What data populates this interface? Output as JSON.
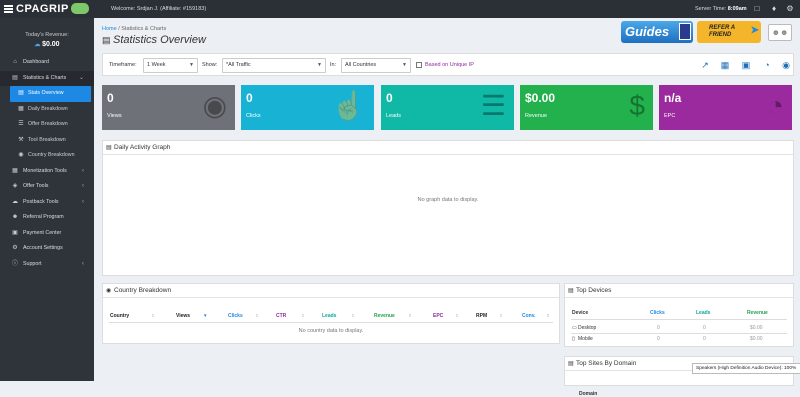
{
  "topbar": {
    "logo": "CPAGRIP",
    "welcome": "Welcome: Srdjan J. (Affiliate: #159183)",
    "server_label": "Server Time:",
    "server_time": "8:09am"
  },
  "sidebar": {
    "revenue_label": "Today's Revenue:",
    "revenue_value": "$0.00",
    "items": [
      {
        "label": "Dashboard"
      },
      {
        "label": "Statistics & Charts"
      },
      {
        "label": "Stats Overview"
      },
      {
        "label": "Daily Breakdown"
      },
      {
        "label": "Offer Breakdown"
      },
      {
        "label": "Tool Breakdown"
      },
      {
        "label": "Country Breakdown"
      },
      {
        "label": "Monetization Tools"
      },
      {
        "label": "Offer Tools"
      },
      {
        "label": "Postback Tools"
      },
      {
        "label": "Referral Program"
      },
      {
        "label": "Payment Center"
      },
      {
        "label": "Account Settings"
      },
      {
        "label": "Support"
      }
    ]
  },
  "breadcrumb": {
    "home": "Home",
    "sep": "/",
    "current": "Statistics & Charts"
  },
  "page_title": "Statistics Overview",
  "promos": {
    "guides": "Guides",
    "refer_line1": "REFER A",
    "refer_line2": "FRIEND"
  },
  "filters": {
    "timeframe_label": "Timeframe:",
    "timeframe_value": "1 Week",
    "show_label": "Show:",
    "show_value": "*All Traffic",
    "in_label": "In:",
    "in_value": "All Countries",
    "unique_label": "Based on Unique IP"
  },
  "cards": [
    {
      "value": "0",
      "label": "Views",
      "color": "#6e7177"
    },
    {
      "value": "0",
      "label": "Clicks",
      "color": "#18b2d4"
    },
    {
      "value": "0",
      "label": "Leads",
      "color": "#0fb9a6"
    },
    {
      "value": "$0.00",
      "label": "Revenue",
      "color": "#22b14c"
    },
    {
      "value": "n/a",
      "label": "EPC",
      "color": "#9a2a9d"
    }
  ],
  "activity": {
    "title": "Daily Activity Graph",
    "empty": "No graph data to display."
  },
  "country": {
    "title": "Country Breakdown",
    "columns": [
      "Country",
      "Views",
      "Clicks",
      "CTR",
      "Leads",
      "Revenue",
      "EPC",
      "RPM",
      "Conv."
    ],
    "column_colors": [
      "#222",
      "#222",
      "#1e88e5",
      "#8e2b9e",
      "#0fa89a",
      "#22a14c",
      "#8e2b9e",
      "#222",
      "#1e88e5"
    ],
    "empty": "No country data to display."
  },
  "devices": {
    "title": "Top Devices",
    "columns": [
      "Device",
      "Clicks",
      "Leads",
      "Revenue"
    ],
    "rows": [
      {
        "device": "Desktop",
        "clicks": "0",
        "leads": "0",
        "revenue": "$0.00"
      },
      {
        "device": "Mobile",
        "clicks": "0",
        "leads": "0",
        "revenue": "$0.00"
      }
    ]
  },
  "sites": {
    "title": "Top Sites By Domain",
    "col_domain": "Domain"
  },
  "tooltip": "Speakers (High Definition Audio Device): 100%"
}
